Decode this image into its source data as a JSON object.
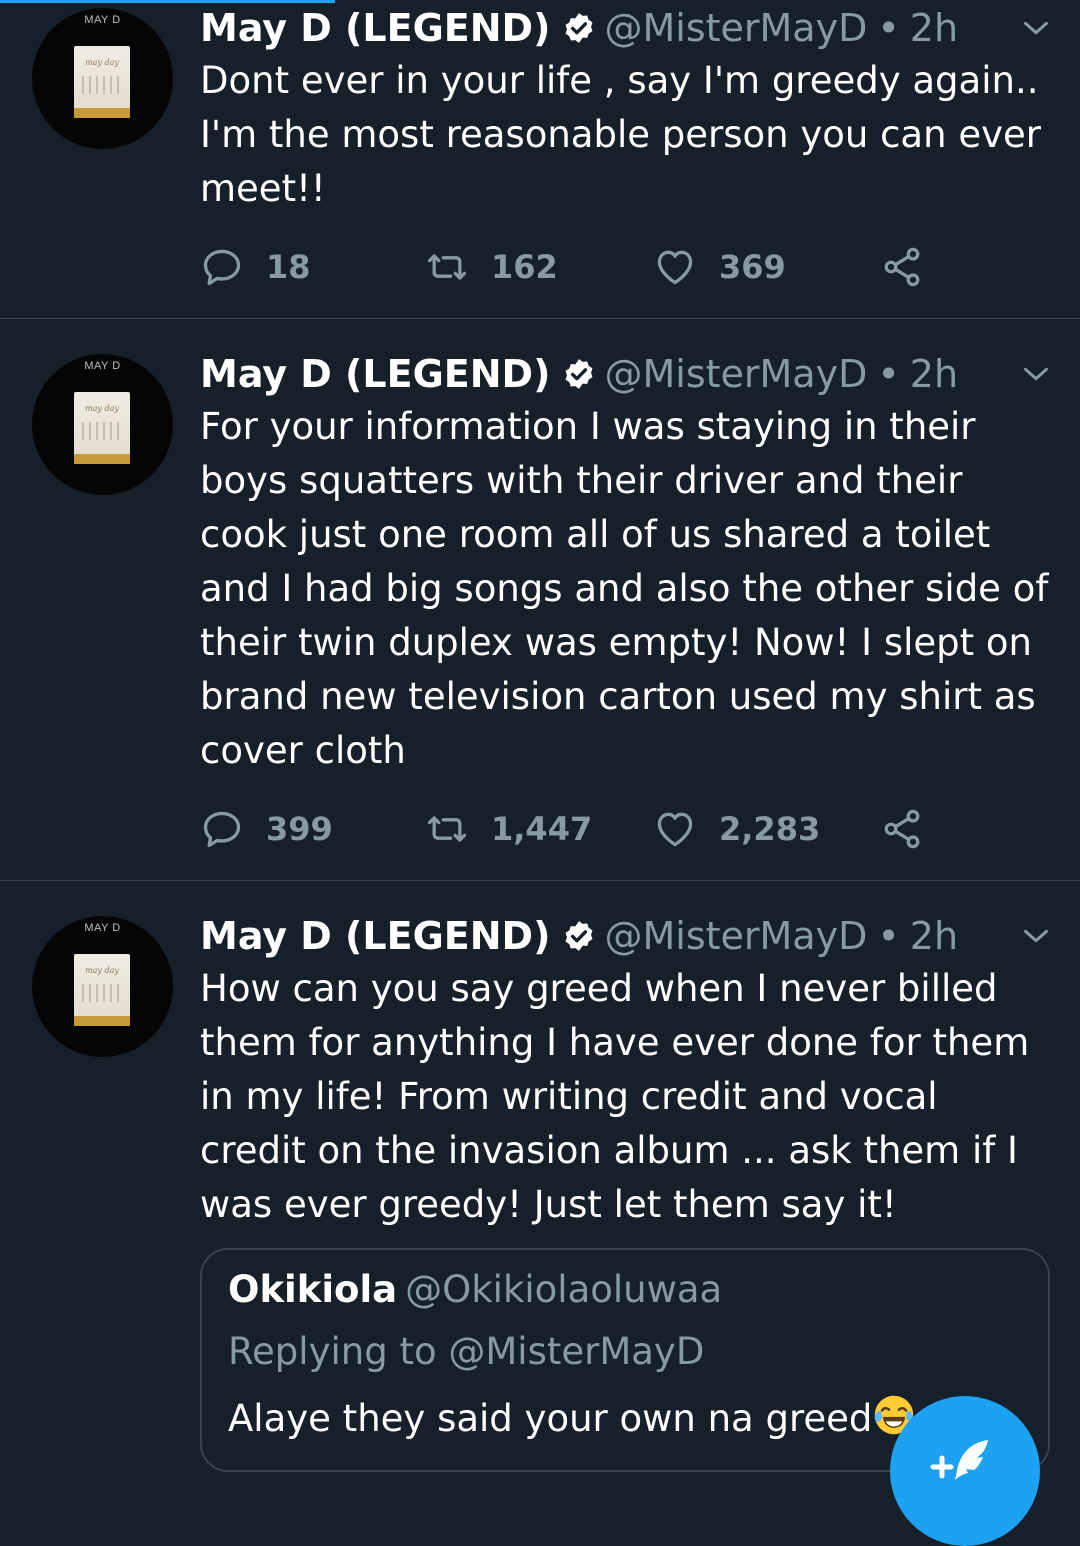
{
  "colors": {
    "background": "#15202b",
    "accent": "#1da1f2",
    "muted": "#8899a6",
    "divider": "#38444d"
  },
  "tweets": [
    {
      "avatar_label": "MAY D",
      "album_script": "may day",
      "name": "May D (LEGEND)",
      "handle": "@MisterMayD",
      "dot": "•",
      "time": "2h",
      "lines": [
        "Dont ever in your life , say I'm greedy again..",
        "I'm the most reasonable person you can ever",
        "meet!!"
      ],
      "replies": "18",
      "retweets": "162",
      "likes": "369"
    },
    {
      "avatar_label": "MAY D",
      "album_script": "may day",
      "name": "May D (LEGEND)",
      "handle": "@MisterMayD",
      "dot": "•",
      "time": "2h",
      "lines": [
        "For your information I was staying in their",
        "boys squatters with their driver and their",
        "cook just one room all of us shared a toilet",
        "and I had big songs and also the other side of",
        "their twin duplex was empty! Now! I slept on",
        "brand new television carton used my shirt as",
        "cover cloth"
      ],
      "replies": "399",
      "retweets": "1,447",
      "likes": "2,283"
    },
    {
      "avatar_label": "MAY D",
      "album_script": "may day",
      "name": "May D (LEGEND)",
      "handle": "@MisterMayD",
      "dot": "•",
      "time": "2h",
      "lines": [
        "How can you say greed when I never billed",
        "them for anything I have ever done for them",
        "in my life! From writing credit and vocal",
        "credit on the invasion album ... ask them if I",
        "was ever greedy! Just let them say it!"
      ],
      "quote": {
        "name": "Okikiola",
        "handle": "@Okikiolaoluwaa",
        "reply_prefix": "Replying to ",
        "reply_handle": "@MisterMayD",
        "text": "Alaye they said your own na greed",
        "emoji": "face-with-tears-of-joy"
      }
    }
  ],
  "icons": {
    "reply": "reply-icon",
    "retweet": "retweet-icon",
    "like": "heart-icon",
    "share": "share-icon",
    "chevron": "chevron-down-icon",
    "verified": "verified-badge-icon",
    "fab": "compose-tweet-icon"
  }
}
